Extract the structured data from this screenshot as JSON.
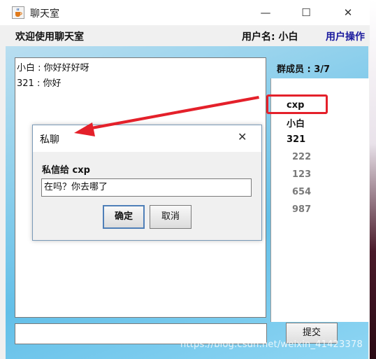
{
  "window": {
    "title": "聊天室",
    "min_glyph": "—",
    "max_glyph": "☐",
    "close_glyph": "✕"
  },
  "header": {
    "welcome": "欢迎使用聊天室",
    "username": "用户名: 小白",
    "user_ops": "用户操作"
  },
  "chat": {
    "messages": [
      "小白 : 你好好好呀",
      "321 : 你好"
    ]
  },
  "members": {
    "title": "群成员 : 3/7",
    "list": [
      "cxp",
      "小白",
      "321",
      "222",
      "123",
      "654",
      "987"
    ]
  },
  "dialog": {
    "title": "私聊",
    "close_glyph": "✕",
    "label": "私信给 cxp",
    "input_value": "在吗？你去哪了",
    "ok_label": "确定",
    "cancel_label": "取消"
  },
  "footer": {
    "submit_label": "提交"
  },
  "annotation": {
    "color": "#e4202a"
  },
  "watermark": "https://blog.csdn.net/weixin_41423378"
}
